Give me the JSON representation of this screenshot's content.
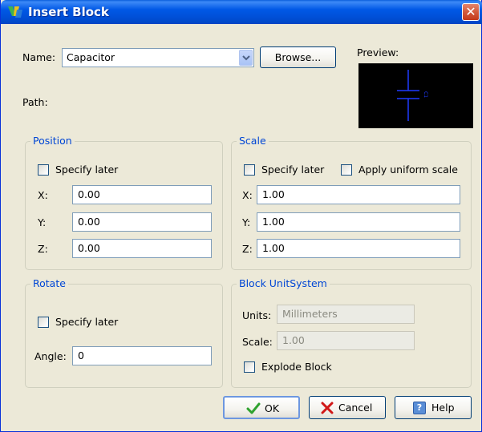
{
  "window": {
    "title": "Insert Block",
    "close_glyph": "✕"
  },
  "name": {
    "label": "Name:",
    "value": "Capacitor",
    "browse_label": "Browse..."
  },
  "path": {
    "label": "Path:"
  },
  "preview": {
    "label": "Preview:",
    "background": "#000000",
    "symbol_color": "#1f3bff",
    "symbol_text": "C1"
  },
  "position": {
    "title": "Position",
    "specify_later_label": "Specify later",
    "specify_later_checked": false,
    "x_label": "X:",
    "x_value": "0.00",
    "y_label": "Y:",
    "y_value": "0.00",
    "z_label": "Z:",
    "z_value": "0.00"
  },
  "scale": {
    "title": "Scale",
    "specify_later_label": "Specify later",
    "specify_later_checked": false,
    "uniform_label": "Apply uniform scale",
    "uniform_checked": false,
    "x_label": "X:",
    "x_value": "1.00",
    "y_label": "Y:",
    "y_value": "1.00",
    "z_label": "Z:",
    "z_value": "1.00"
  },
  "rotate": {
    "title": "Rotate",
    "specify_later_label": "Specify later",
    "specify_later_checked": false,
    "angle_label": "Angle:",
    "angle_value": "0"
  },
  "unit_system": {
    "title": "Block UnitSystem",
    "units_label": "Units:",
    "units_value": "Millimeters",
    "scale_label": "Scale:",
    "scale_value": "1.00",
    "explode_label": "Explode Block",
    "explode_checked": false
  },
  "footer": {
    "ok_label": "OK",
    "cancel_label": "Cancel",
    "help_label": "Help"
  },
  "colors": {
    "titlebar": "#0054e3",
    "dialog_bg": "#ece9d8",
    "group_title": "#0046d5",
    "ok_check": "#2fa22f",
    "cancel_x": "#d11818",
    "help_icon": "#5a8ed6"
  }
}
